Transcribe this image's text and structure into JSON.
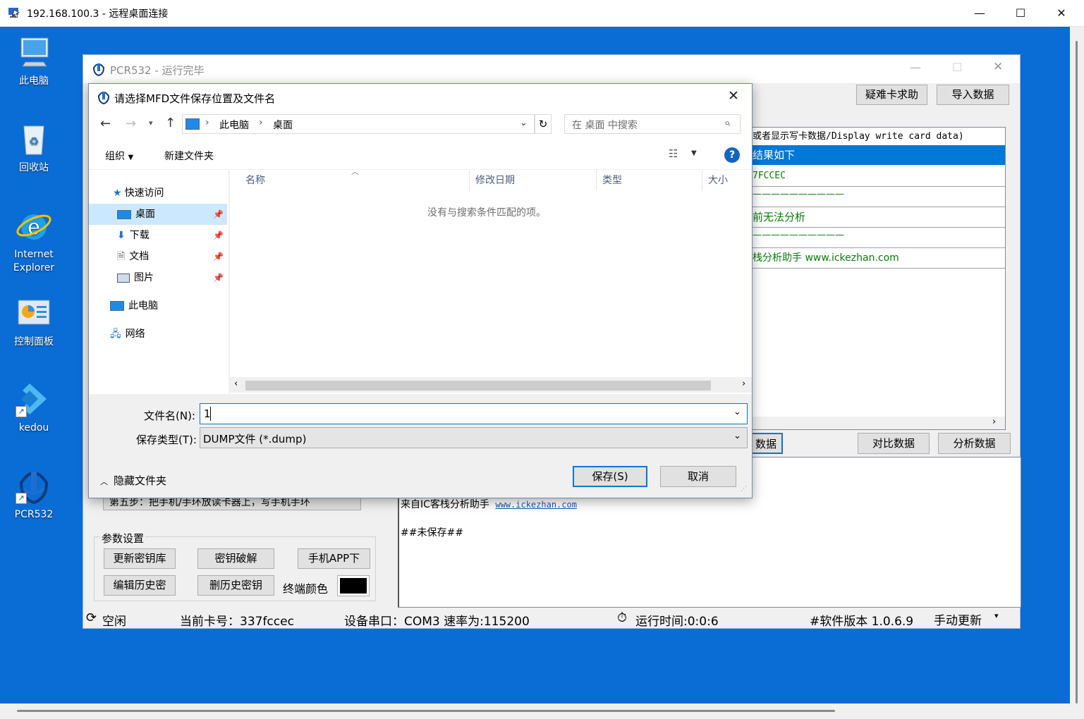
{
  "rdp": {
    "title": "192.168.100.3 - 远程桌面连接",
    "minimize": "—",
    "maximize": "☐",
    "close": "✕"
  },
  "desktop_icons": [
    {
      "label": "此电脑"
    },
    {
      "label": "回收站"
    },
    {
      "label": "Internet Explorer"
    },
    {
      "label": "控制面板"
    },
    {
      "label": "kedou"
    },
    {
      "label": "PCR532"
    }
  ],
  "pcr": {
    "title": "PCR532 - 运行完毕",
    "buttons": {
      "help": "疑难卡求助",
      "import": "导入数据",
      "compare": "对比数据",
      "analyze": "分析数据",
      "partial": "数据"
    },
    "output_rows": [
      "或者显示写卡数据/Display write card data)",
      "结果如下",
      "7FCCEC",
      "——————————",
      "前无法分析",
      "——————————",
      "栈分析助手 www.ickezhan.com"
    ],
    "log": {
      "partial_top": "来自IC客栈分析助手",
      "divider": "————————————",
      "line1": "来自IC客栈分析助手",
      "link": "www.ickezhan.com",
      "unsaved": "##未保存##"
    },
    "step5": "第五步：把手机/手环放读卡器上，写手机手环",
    "params": {
      "legend": "参数设置",
      "update_keys": "更新密钥库",
      "crack_keys": "密钥破解",
      "phone_app": "手机APP下",
      "edit_history": "编辑历史密",
      "delete_history": "删历史密钥",
      "terminal_color_label": "终端颜色",
      "terminal_color": "#000000"
    },
    "status": {
      "state": "空闲",
      "card": "当前卡号：337fccec",
      "port": "设备串口：COM3 速率为:115200",
      "runtime": "运行时间:0:0:6",
      "version": "#软件版本 1.0.6.9",
      "update": "手动更新"
    }
  },
  "dialog": {
    "title": "请选择MFD文件保存位置及文件名",
    "breadcrumb": [
      "此电脑",
      "桌面"
    ],
    "search_placeholder": "在 桌面 中搜索",
    "toolbar": {
      "organize": "组织",
      "new_folder": "新建文件夹"
    },
    "nav": {
      "quick_access": "快速访问",
      "items": [
        "桌面",
        "下载",
        "文档",
        "图片"
      ],
      "this_pc": "此电脑",
      "network": "网络"
    },
    "columns": [
      "名称",
      "修改日期",
      "类型",
      "大小"
    ],
    "empty_message": "没有与搜索条件匹配的项。",
    "filename_label": "文件名(N):",
    "filename_value": "1",
    "filetype_label": "保存类型(T):",
    "filetype_value": "DUMP文件 (*.dump)",
    "hide_folders": "隐藏文件夹",
    "save": "保存(S)",
    "cancel": "取消"
  },
  "colors": {
    "desktop": "#0a6cd5",
    "selection": "#0078d7",
    "accent_link": "#1a56b8"
  }
}
